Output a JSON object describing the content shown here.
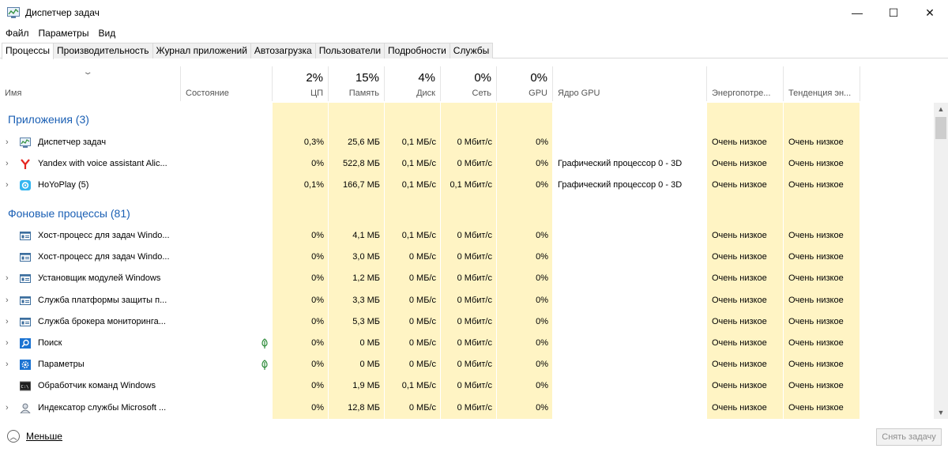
{
  "window": {
    "title": "Диспетчер задач",
    "min": "—",
    "max": "☐",
    "close": "✕"
  },
  "menu": [
    "Файл",
    "Параметры",
    "Вид"
  ],
  "tabs": [
    "Процессы",
    "Производительность",
    "Журнал приложений",
    "Автозагрузка",
    "Пользователи",
    "Подробности",
    "Службы"
  ],
  "columns": {
    "name": "Имя",
    "state": "Состояние",
    "cpu": {
      "pct": "2%",
      "label": "ЦП"
    },
    "mem": {
      "pct": "15%",
      "label": "Память"
    },
    "disk": {
      "pct": "4%",
      "label": "Диск"
    },
    "net": {
      "pct": "0%",
      "label": "Сеть"
    },
    "gpu": {
      "pct": "0%",
      "label": "GPU"
    },
    "gpu_engine": "Ядро GPU",
    "power": "Энергопотре...",
    "power_trend": "Тенденция эн..."
  },
  "groups": {
    "apps": "Приложения (3)",
    "background": "Фоновые процессы (81)"
  },
  "apps": [
    {
      "name": "Диспетчер задач",
      "icon": "task-manager-icon",
      "cpu": "0,3%",
      "mem": "25,6 МБ",
      "disk": "0,1 МБ/с",
      "net": "0 Мбит/с",
      "gpu": "0%",
      "engine": "",
      "power": "Очень низкое",
      "trend": "Очень низкое"
    },
    {
      "name": "Yandex with voice assistant Alic...",
      "icon": "yandex-icon",
      "cpu": "0%",
      "mem": "522,8 МБ",
      "disk": "0,1 МБ/с",
      "net": "0 Мбит/с",
      "gpu": "0%",
      "engine": "Графический процессор 0 - 3D",
      "power": "Очень низкое",
      "trend": "Очень низкое"
    },
    {
      "name": "HoYoPlay (5)",
      "icon": "hoyoplay-icon",
      "cpu": "0,1%",
      "mem": "166,7 МБ",
      "disk": "0,1 МБ/с",
      "net": "0,1 Мбит/с",
      "gpu": "0%",
      "engine": "Графический процессор 0 - 3D",
      "power": "Очень низкое",
      "trend": "Очень низкое"
    }
  ],
  "background": [
    {
      "name": "Хост-процесс для задач Windo...",
      "icon": "window-process-icon",
      "expand": false,
      "leaf": false,
      "cpu": "0%",
      "mem": "4,1 МБ",
      "disk": "0,1 МБ/с",
      "net": "0 Мбит/с",
      "gpu": "0%",
      "power": "Очень низкое",
      "trend": "Очень низкое"
    },
    {
      "name": "Хост-процесс для задач Windo...",
      "icon": "window-process-icon",
      "expand": false,
      "leaf": false,
      "cpu": "0%",
      "mem": "3,0 МБ",
      "disk": "0 МБ/с",
      "net": "0 Мбит/с",
      "gpu": "0%",
      "power": "Очень низкое",
      "trend": "Очень низкое"
    },
    {
      "name": "Установщик модулей Windows",
      "icon": "window-process-icon",
      "expand": true,
      "leaf": false,
      "cpu": "0%",
      "mem": "1,2 МБ",
      "disk": "0 МБ/с",
      "net": "0 Мбит/с",
      "gpu": "0%",
      "power": "Очень низкое",
      "trend": "Очень низкое"
    },
    {
      "name": "Служба платформы защиты п...",
      "icon": "window-process-icon",
      "expand": true,
      "leaf": false,
      "cpu": "0%",
      "mem": "3,3 МБ",
      "disk": "0 МБ/с",
      "net": "0 Мбит/с",
      "gpu": "0%",
      "power": "Очень низкое",
      "trend": "Очень низкое"
    },
    {
      "name": "Служба брокера мониторинга...",
      "icon": "window-process-icon",
      "expand": true,
      "leaf": false,
      "cpu": "0%",
      "mem": "5,3 МБ",
      "disk": "0 МБ/с",
      "net": "0 Мбит/с",
      "gpu": "0%",
      "power": "Очень низкое",
      "trend": "Очень низкое"
    },
    {
      "name": "Поиск",
      "icon": "search-app-icon",
      "expand": true,
      "leaf": true,
      "cpu": "0%",
      "mem": "0 МБ",
      "disk": "0 МБ/с",
      "net": "0 Мбит/с",
      "gpu": "0%",
      "power": "Очень низкое",
      "trend": "Очень низкое"
    },
    {
      "name": "Параметры",
      "icon": "settings-gear-icon",
      "expand": true,
      "leaf": true,
      "cpu": "0%",
      "mem": "0 МБ",
      "disk": "0 МБ/с",
      "net": "0 Мбит/с",
      "gpu": "0%",
      "power": "Очень низкое",
      "trend": "Очень низкое"
    },
    {
      "name": "Обработчик команд Windows",
      "icon": "console-icon",
      "expand": false,
      "leaf": false,
      "cpu": "0%",
      "mem": "1,9 МБ",
      "disk": "0,1 МБ/с",
      "net": "0 Мбит/с",
      "gpu": "0%",
      "power": "Очень низкое",
      "trend": "Очень низкое"
    },
    {
      "name": "Индексатор службы Microsoft ...",
      "icon": "indexer-user-icon",
      "expand": true,
      "leaf": false,
      "cpu": "0%",
      "mem": "12,8 МБ",
      "disk": "0 МБ/с",
      "net": "0 Мбит/с",
      "gpu": "0%",
      "power": "Очень низкое",
      "trend": "Очень низкое"
    }
  ],
  "footer": {
    "less": "Меньше",
    "end_task": "Снять задачу"
  },
  "colors": {
    "accent": "#1a5fb4",
    "heat": "#fff4c4"
  }
}
